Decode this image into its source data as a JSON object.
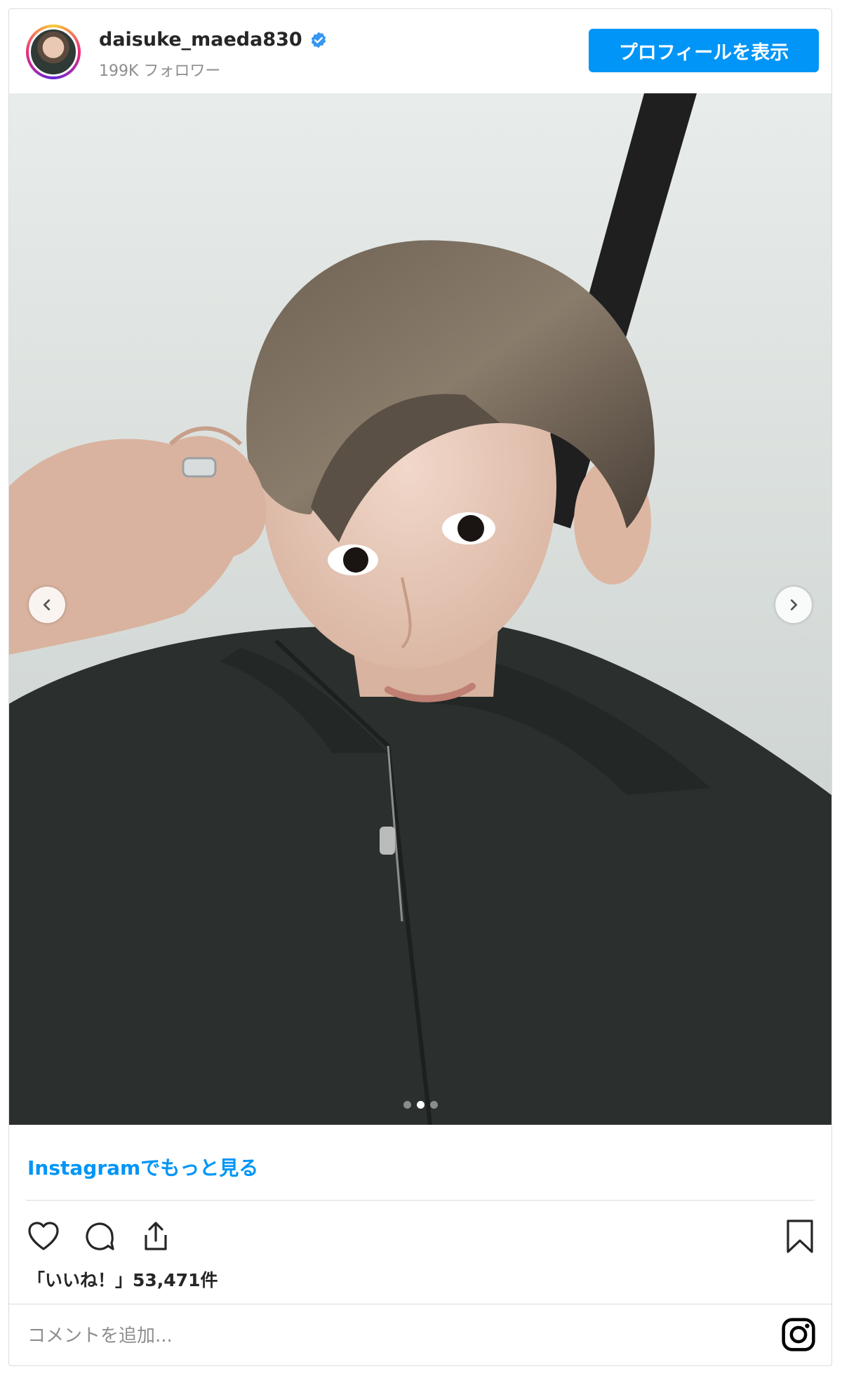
{
  "header": {
    "username": "daisuke_maeda830",
    "followers": "199K フォロワー",
    "profile_button": "プロフィールを表示"
  },
  "carousel": {
    "total": 3,
    "active_index": 1
  },
  "more_link": "Instagramでもっと見る",
  "likes": "「いいね！」53,471件",
  "comment": {
    "placeholder": "コメントを追加..."
  },
  "icons": {
    "verified": "verified-badge-icon",
    "like": "heart-icon",
    "comment": "comment-icon",
    "share": "share-icon",
    "save": "bookmark-icon",
    "prev": "chevron-left-icon",
    "next": "chevron-right-icon",
    "brand": "instagram-icon"
  },
  "colors": {
    "accent": "#0095f6",
    "text": "#262626",
    "muted": "#8e8e8e",
    "border": "#dbdbdb"
  }
}
